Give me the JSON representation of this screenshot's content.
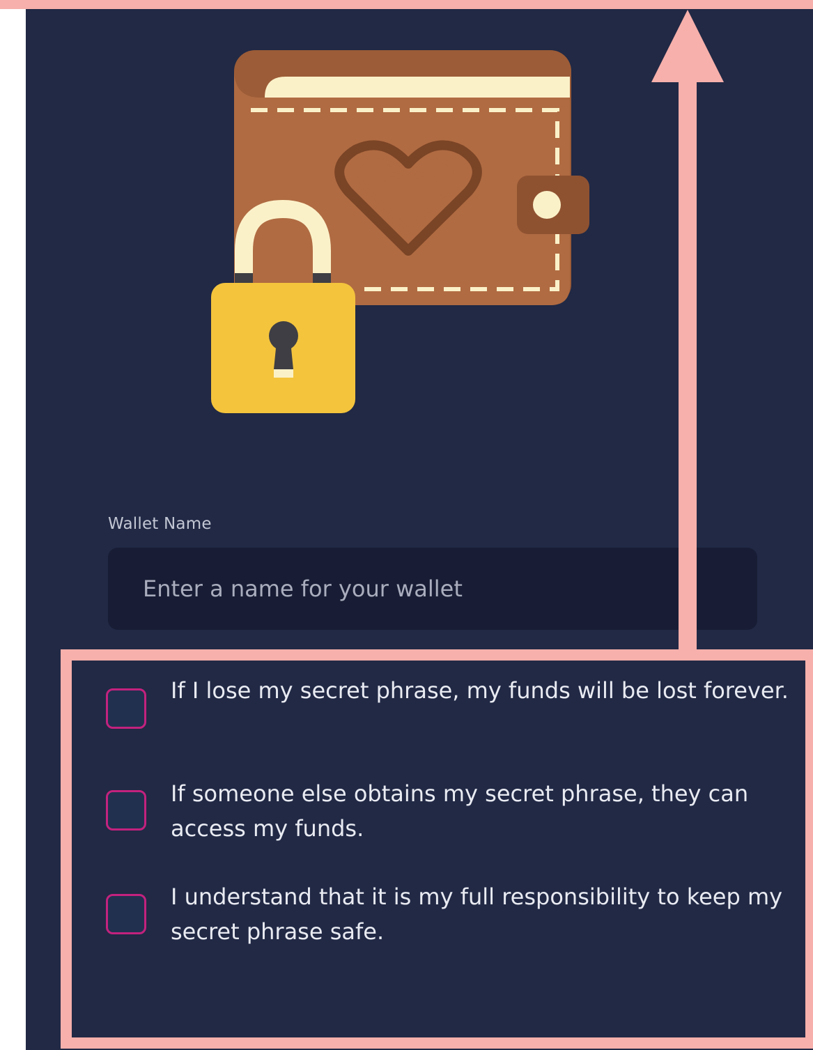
{
  "form": {
    "wallet_name_label": "Wallet Name",
    "wallet_name_placeholder": "Enter a name for your wallet",
    "wallet_name_value": ""
  },
  "acknowledgements": [
    {
      "label": "If I lose my secret phrase, my funds will be lost forever.",
      "checked": false
    },
    {
      "label": "If someone else obtains my secret phrase, they can access my funds.",
      "checked": false
    },
    {
      "label": "I understand that it is my full responsibility to keep my secret phrase safe.",
      "checked": false
    }
  ],
  "illustration": {
    "icon": "wallet-with-padlock-icon"
  },
  "annotation": {
    "color": "#f7b0ab",
    "arrow_direction": "up"
  },
  "colors": {
    "panel_background": "#212945",
    "input_background": "#181d35",
    "checkbox_border": "#c3227e",
    "checkbox_fill": "#22304f"
  }
}
